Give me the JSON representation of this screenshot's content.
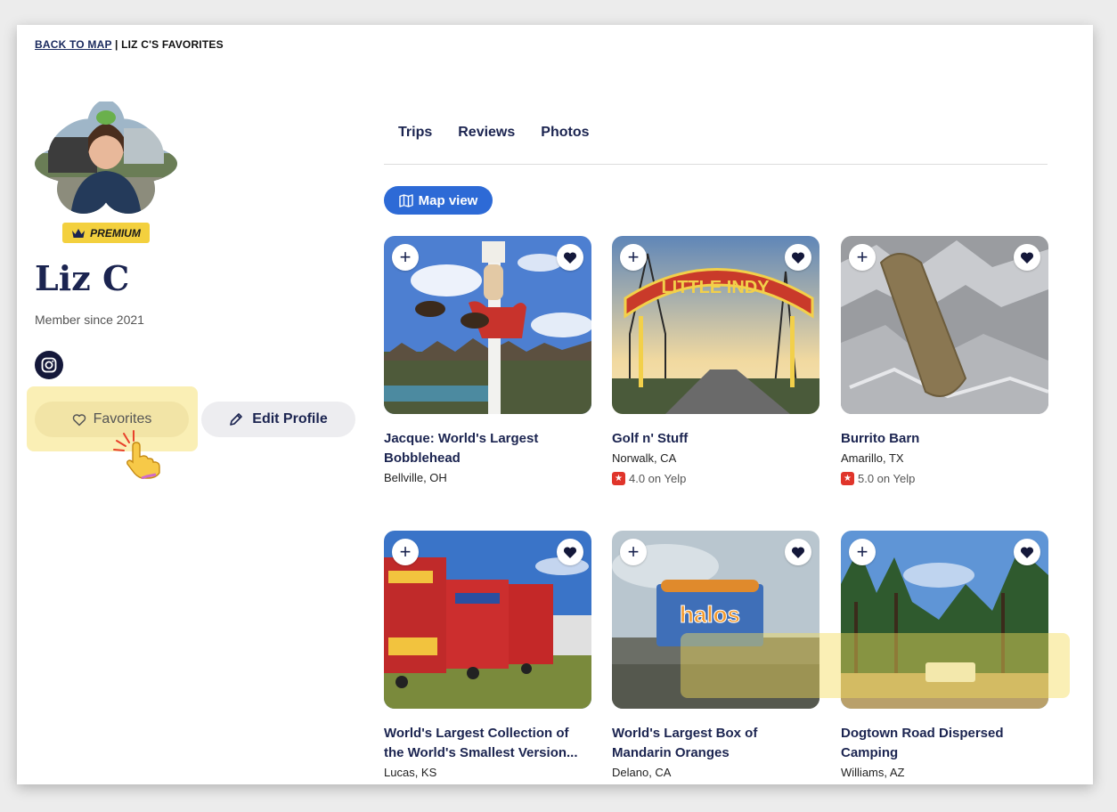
{
  "breadcrumb": {
    "back_label": "BACK TO MAP",
    "separator": " | ",
    "current": "LIZ C'S FAVORITES"
  },
  "profile": {
    "badge": "PREMIUM",
    "name": "Liz C",
    "member_since": "Member since 2021",
    "favorites_label": "Favorites",
    "edit_label": "Edit Profile"
  },
  "tabs": [
    {
      "label": "Trips"
    },
    {
      "label": "Reviews"
    },
    {
      "label": "Photos"
    }
  ],
  "map_view_label": "Map view",
  "cards": [
    {
      "title": "Jacque: World's Largest Bobblehead",
      "location": "Bellville, OH",
      "rating": ""
    },
    {
      "title": "Golf n' Stuff",
      "location": "Norwalk, CA",
      "rating": "4.0 on Yelp"
    },
    {
      "title": "Burrito Barn",
      "location": "Amarillo, TX",
      "rating": "5.0 on Yelp"
    },
    {
      "title": "World's Largest Collection of the World's Smallest Version...",
      "location": "Lucas, KS",
      "rating": ""
    },
    {
      "title": "World's Largest Box of Mandarin Oranges",
      "location": "Delano, CA",
      "rating": ""
    },
    {
      "title": "Dogtown Road Dispersed Camping",
      "location": "Williams, AZ",
      "rating": ""
    }
  ],
  "sign_text": "halos",
  "arch_text": "LITTLE INDY",
  "colors": {
    "navy": "#1b2450",
    "accent_blue": "#2d6ad6",
    "premium_yellow": "#f3d03e",
    "yelp_red": "#e0352b"
  },
  "icons": [
    "heart-icon",
    "plus-icon",
    "pencil-icon",
    "instagram-icon",
    "map-icon",
    "crown-icon",
    "pointing-hand-icon"
  ]
}
